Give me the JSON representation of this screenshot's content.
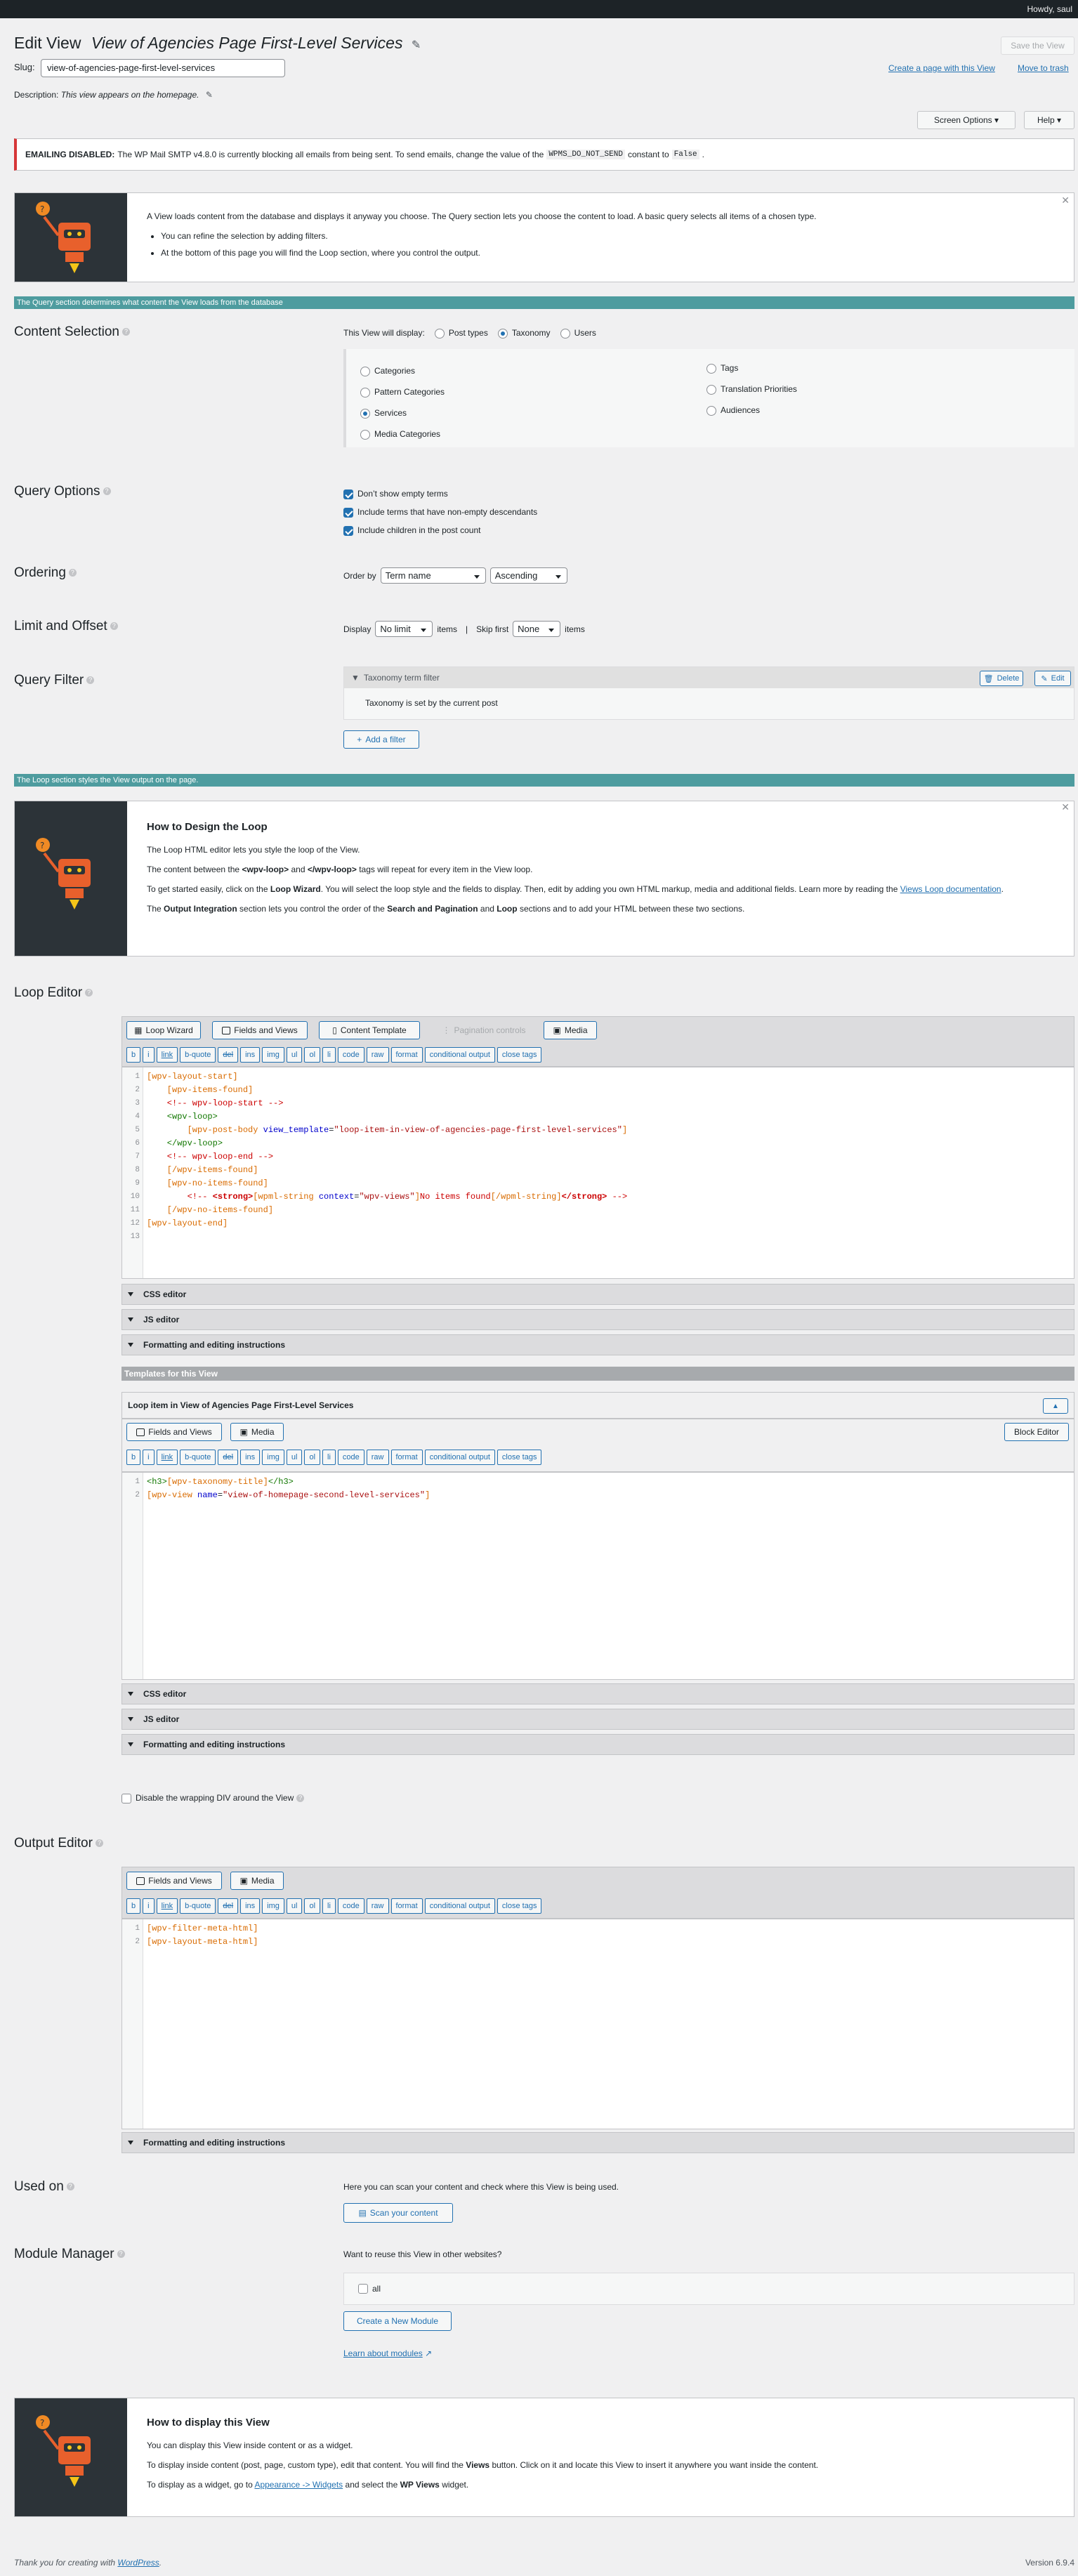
{
  "adminbar": {
    "howdy": "Howdy, saul"
  },
  "header": {
    "title_prefix": "Edit View",
    "title": "View of Agencies Page First-Level Services",
    "save_label": "Save the View",
    "create_page_link": "Create a page with this View",
    "trash_link": "Move to trash",
    "slug_label": "Slug:",
    "slug_value": "view-of-agencies-page-first-level-services",
    "desc_label": "Description:",
    "desc_value": "This view appears on the homepage."
  },
  "screen_options": "Screen Options",
  "help": "Help",
  "notice": {
    "strong": "EMAILING DISABLED:",
    "text": "The WP Mail SMTP v4.8.0 is currently blocking all emails from being sent. To send emails, change the value of the",
    "code1": "WPMS_DO_NOT_SEND",
    "mid": "constant to",
    "code2": "False",
    "end": "."
  },
  "intro": {
    "p1": "A View loads content from the database and displays it anyway you choose. The Query section lets you choose the content to load. A basic query selects all items of a chosen type.",
    "b1": "You can refine the selection by adding filters.",
    "b2": "At the bottom of this page you will find the Loop section, where you control the output."
  },
  "query_sep": "The Query section determines what content the View loads from the database",
  "content_selection": {
    "title": "Content Selection",
    "display_label": "This View will display:",
    "types": [
      "Post types",
      "Taxonomy",
      "Users"
    ],
    "left": [
      "Categories",
      "Pattern Categories",
      "Services",
      "Media Categories"
    ],
    "right": [
      "Tags",
      "Translation Priorities",
      "Audiences"
    ]
  },
  "query_options": {
    "title": "Query Options",
    "items": [
      "Don’t show empty terms",
      "Include terms that have non-empty descendants",
      "Include children in the post count"
    ]
  },
  "ordering": {
    "title": "Ordering",
    "order_by": "Order by",
    "field": "Term name",
    "dir": "Ascending"
  },
  "limit": {
    "title": "Limit and Offset",
    "display": "Display",
    "limit": "No limit",
    "items": "items",
    "sep": "|",
    "skip": "Skip first",
    "skip_val": "None",
    "items2": "items"
  },
  "query_filter": {
    "title": "Query Filter",
    "filter_name": "Taxonomy term filter",
    "delete": "Delete",
    "edit": "Edit",
    "desc": "Taxonomy is set by the current post",
    "add": "Add a filter"
  },
  "loop_sep": "The Loop section styles the View output on the page.",
  "design": {
    "title": "How to Design the Loop",
    "p1": "The Loop HTML editor lets you style the loop of the View.",
    "p2a": "The content between the",
    "p2b": "<wpv-loop>",
    "p2c": "and",
    "p2d": "</wpv-loop>",
    "p2e": "tags will repeat for every item in the View loop.",
    "p3a": "To get started easily, click on the",
    "p3b": "Loop Wizard",
    "p3c": ". You will select the loop style and the fields to display. Then, edit by adding you own HTML markup, media and additional fields. Learn more by reading the",
    "p3d": "Views Loop documentation",
    "p3e": ".",
    "p4a": "The",
    "p4b": "Output Integration",
    "p4c": "section lets you control the order of the",
    "p4d": "Search and Pagination",
    "p4e": "and",
    "p4f": "Loop",
    "p4g": "sections and to add your HTML between these two sections."
  },
  "loop_editor": {
    "title": "Loop Editor",
    "buttons": [
      "Loop Wizard",
      "Fields and Views",
      "Content Template",
      "Pagination controls",
      "Media"
    ],
    "quicktags": [
      "b",
      "i",
      "link",
      "b-quote",
      "del",
      "ins",
      "img",
      "ul",
      "ol",
      "li",
      "code",
      "raw",
      "format",
      "conditional output",
      "close tags"
    ],
    "line_numbers": [
      "1",
      "2",
      "3",
      "4",
      "5",
      "6",
      "7",
      "8",
      "9",
      "10",
      "11",
      "12",
      "13"
    ],
    "css": "CSS editor",
    "js": "JS editor",
    "fmt": "Formatting and editing instructions"
  },
  "templates": {
    "header": "Templates for this View",
    "name": "Loop item in View of Agencies Page First-Level Services",
    "block_editor": "Block Editor",
    "buttons": [
      "Fields and Views",
      "Media"
    ],
    "line_numbers": [
      "1",
      "2"
    ],
    "css": "CSS editor",
    "js": "JS editor",
    "fmt": "Formatting and editing instructions"
  },
  "disable_wrap": "Disable the wrapping DIV around the View",
  "output_editor": {
    "title": "Output Editor",
    "buttons": [
      "Fields and Views",
      "Media"
    ],
    "line_numbers": [
      "1",
      "2"
    ],
    "fmt": "Formatting and editing instructions"
  },
  "used_on": {
    "title": "Used on",
    "desc": "Here you can scan your content and check where this View is being used.",
    "button": "Scan your content"
  },
  "module_manager": {
    "title": "Module Manager",
    "question": "Want to reuse this View in other websites?",
    "all": "all",
    "create": "Create a New Module",
    "learn": "Learn about modules"
  },
  "display": {
    "title": "How to display this View",
    "p1": "You can display this View inside content or as a widget.",
    "p2a": "To display inside content (post, page, custom type), edit that content. You will find the",
    "p2b": "Views",
    "p2c": "button. Click on it and locate this View to insert it anywhere you want inside the content.",
    "p3a": "To display as a widget, go to",
    "p3b": "Appearance -> Widgets",
    "p3c": "and select the",
    "p3d": "WP Views",
    "p3e": "widget."
  },
  "footer": {
    "thanks": "Thank you for creating with",
    "wp": "WordPress",
    "dot": ".",
    "version": "Version 6.9.4"
  }
}
